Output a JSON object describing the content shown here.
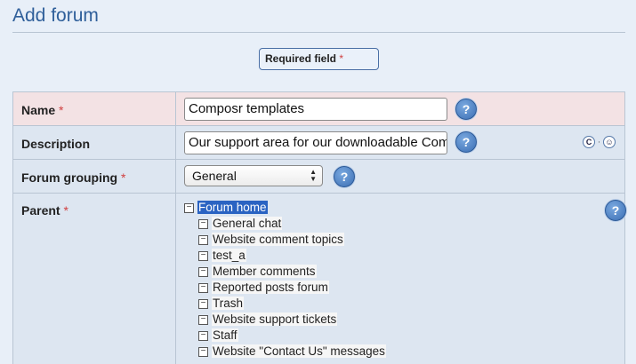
{
  "page": {
    "title": "Add forum"
  },
  "legend": {
    "required_text": "Required field",
    "star": "*"
  },
  "fields": {
    "name": {
      "label": "Name",
      "star": "*",
      "value": "Composr templates"
    },
    "description": {
      "label": "Description",
      "value": "Our support area for our downloadable Comp"
    },
    "forum_grouping": {
      "label": "Forum grouping",
      "star": "*",
      "selected": "General"
    },
    "parent": {
      "label": "Parent",
      "star": "*"
    }
  },
  "help_glyph": "?",
  "editor_icons": {
    "comcode_glyph": "C",
    "separator": "·",
    "wysiwyg_glyph": "☺"
  },
  "tree": {
    "expander_glyph": "−",
    "root": "Forum home",
    "children": [
      "General chat",
      "Website comment topics",
      "test_a",
      "Member comments",
      "Reported posts forum",
      "Trash",
      "Website support tickets",
      "Staff",
      "Website \"Contact Us\" messages"
    ]
  },
  "colors": {
    "title": "#2f5f9a",
    "required_row": "#f3e2e4",
    "row": "#dde6f1",
    "selected": "#2a63c2"
  }
}
